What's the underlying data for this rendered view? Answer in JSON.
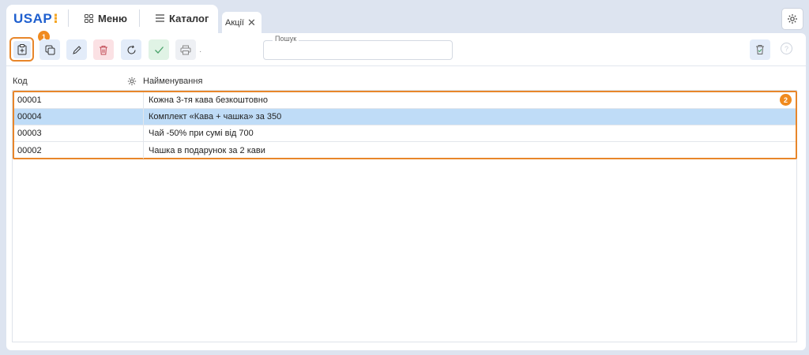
{
  "app": {
    "logo": "USAP",
    "logo_dots": "⁝"
  },
  "nav": {
    "menu_label": "Меню",
    "catalog_label": "Каталог"
  },
  "tab": {
    "label": "Акції",
    "close": "✕"
  },
  "toolbar": {
    "badge_1": "1",
    "badge_2": "2",
    "print_more": "·",
    "help": "?"
  },
  "search": {
    "label": "Пошук",
    "value": "",
    "placeholder": ""
  },
  "table": {
    "columns": [
      "Код",
      "Найменування"
    ],
    "rows": [
      {
        "code": "00001",
        "name": "Кожна 3-тя кава безкоштовно",
        "selected": false
      },
      {
        "code": "00004",
        "name": "Комплект «Кава + чашка» за 350",
        "selected": true
      },
      {
        "code": "00003",
        "name": "Чай -50% при сумі від 700",
        "selected": false
      },
      {
        "code": "00002",
        "name": "Чашка в подарунок за 2 кави",
        "selected": false
      }
    ]
  },
  "colors": {
    "accent": "#1e5fcf",
    "highlight": "#e8862a",
    "selected_row": "#bfdcf7"
  },
  "icons": {
    "toolbar": [
      "add-document-icon",
      "copy-icon",
      "edit-icon",
      "delete-icon",
      "refresh-icon",
      "check-icon",
      "print-icon"
    ],
    "right": [
      "trash-check-icon",
      "help-icon"
    ],
    "top": [
      "grid-icon",
      "hamburger-icon",
      "gear-icon"
    ]
  }
}
